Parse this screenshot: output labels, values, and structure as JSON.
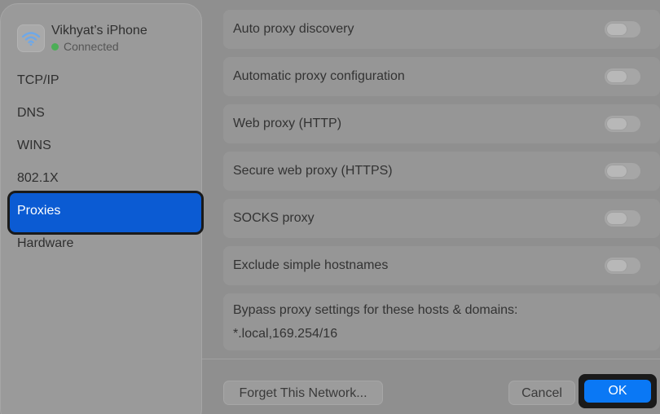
{
  "network": {
    "name": "Vikhyat’s iPhone",
    "status": "Connected",
    "status_color": "#4cae57",
    "icon": "wifi-icon"
  },
  "sidebar": {
    "items": [
      {
        "label": "TCP/IP"
      },
      {
        "label": "DNS"
      },
      {
        "label": "WINS"
      },
      {
        "label": "802.1X"
      },
      {
        "label": "Proxies",
        "active": true
      },
      {
        "label": "Hardware"
      }
    ]
  },
  "proxies": {
    "rows": [
      {
        "label": "Auto proxy discovery",
        "enabled": false
      },
      {
        "label": "Automatic proxy configuration",
        "enabled": false
      },
      {
        "label": "Web proxy (HTTP)",
        "enabled": false
      },
      {
        "label": "Secure web proxy (HTTPS)",
        "enabled": false
      },
      {
        "label": "SOCKS proxy",
        "enabled": false
      },
      {
        "label": "Exclude simple hostnames",
        "enabled": false
      }
    ],
    "bypass_label": "Bypass proxy settings for these hosts & domains:",
    "bypass_value": "*.local,169.254/16"
  },
  "footer": {
    "forget_label": "Forget This Network...",
    "cancel_label": "Cancel",
    "ok_label": "OK"
  },
  "colors": {
    "accent": "#0b5bd3",
    "ok_button": "#0a78f5"
  }
}
